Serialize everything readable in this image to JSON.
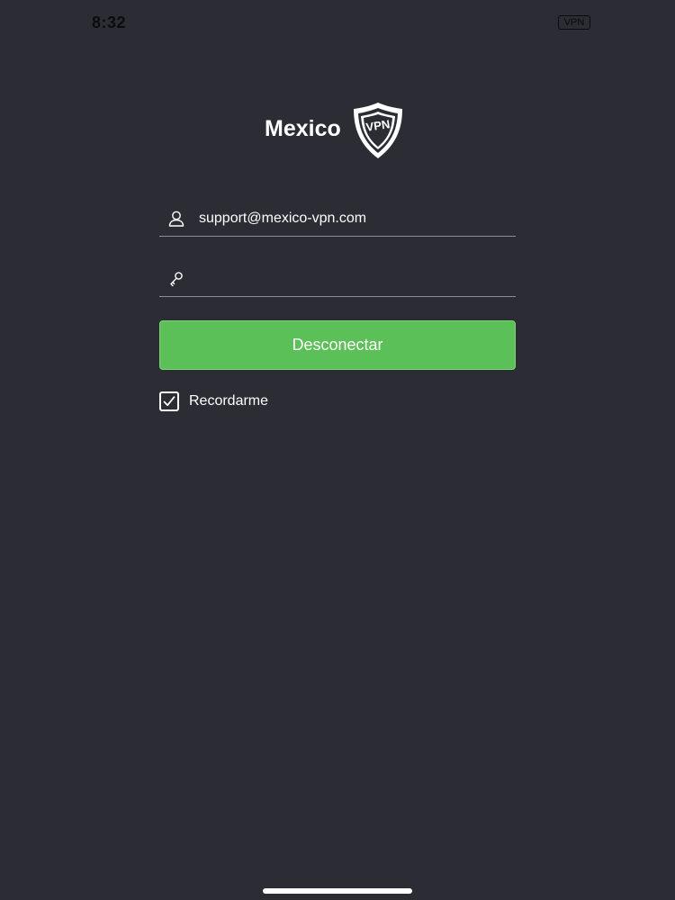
{
  "status_bar": {
    "time": "8:32",
    "vpn_badge": "VPN"
  },
  "logo": {
    "name": "Mexico",
    "badge_text": "VPN"
  },
  "login_form": {
    "username_value": "support@mexico-vpn.com",
    "password_value": "",
    "connect_button_label": "Desconectar",
    "remember_label": "Recordarme",
    "remember_checked": true
  },
  "icons": {
    "username": "user-icon",
    "password": "key-icon",
    "logo": "shield-icon",
    "remember": "checkmark-icon"
  },
  "colors": {
    "background": "#2b2c34",
    "accent": "#5bc057",
    "text": "#ffffff"
  }
}
